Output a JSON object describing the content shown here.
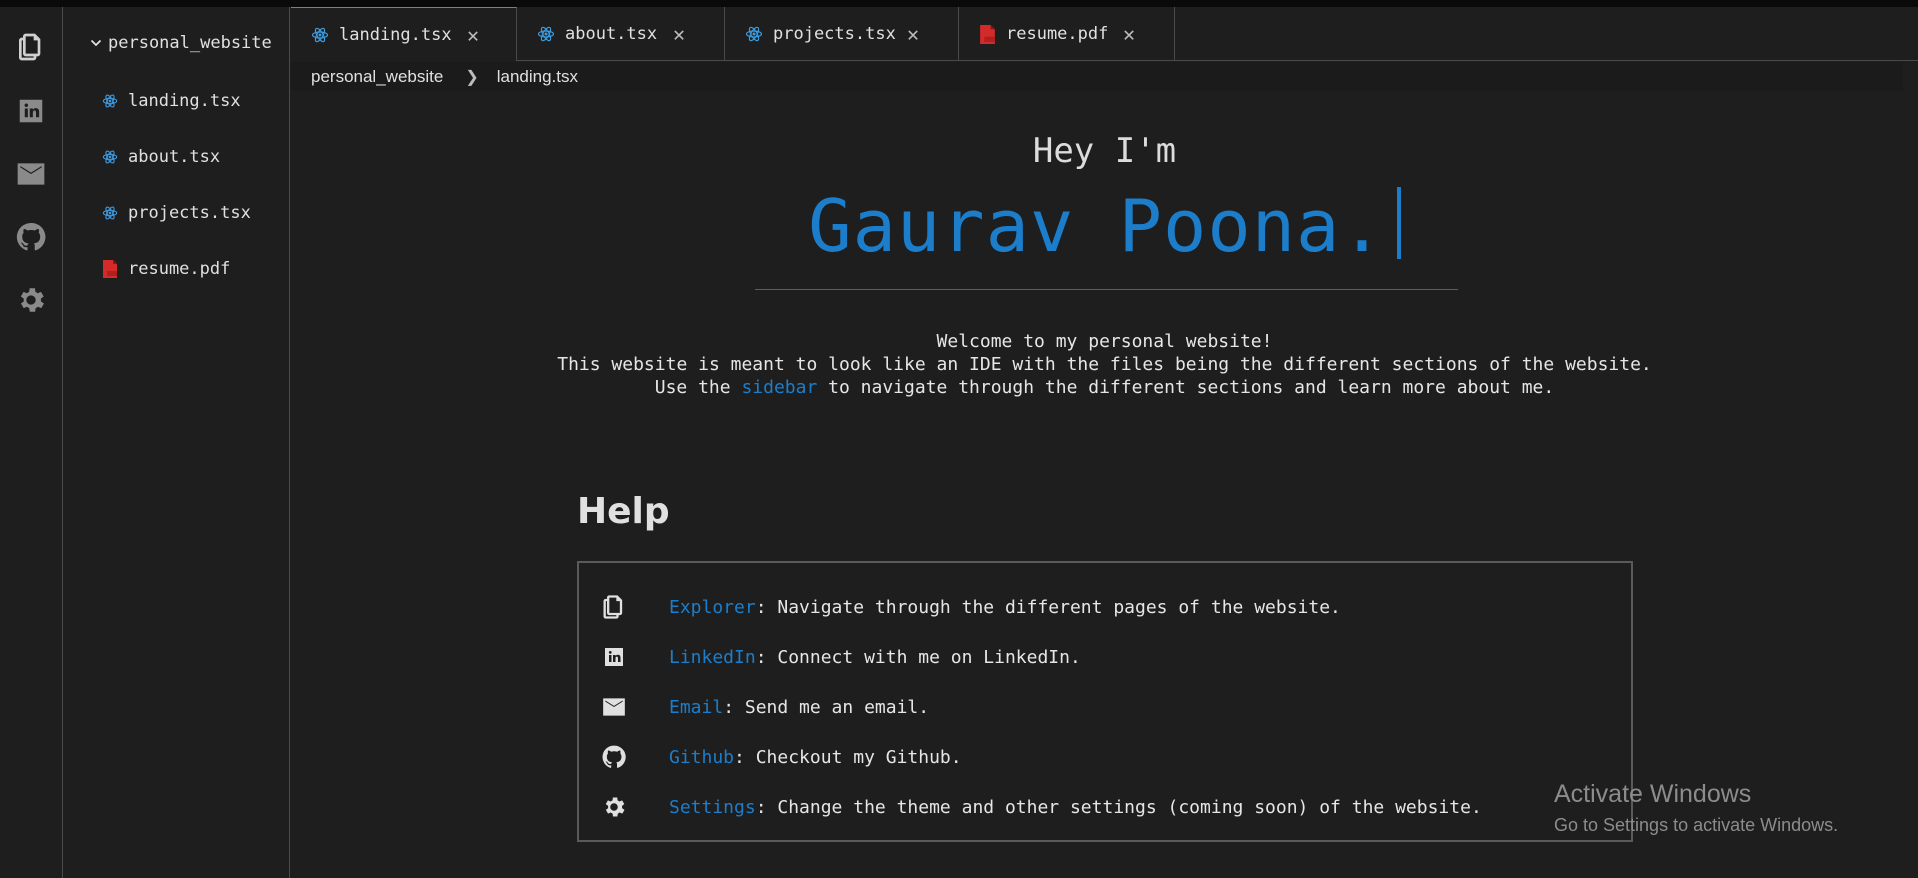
{
  "activity_bar": {
    "items": [
      {
        "name": "explorer",
        "icon": "files-icon"
      },
      {
        "name": "linkedin",
        "icon": "linkedin-icon"
      },
      {
        "name": "email",
        "icon": "mail-icon"
      },
      {
        "name": "github",
        "icon": "github-icon"
      },
      {
        "name": "settings",
        "icon": "gear-icon"
      }
    ]
  },
  "explorer": {
    "folder": "personal_website",
    "files": [
      {
        "label": "landing.tsx",
        "icon": "react-icon"
      },
      {
        "label": "about.tsx",
        "icon": "react-icon"
      },
      {
        "label": "projects.tsx",
        "icon": "react-icon"
      },
      {
        "label": "resume.pdf",
        "icon": "pdf-icon"
      }
    ]
  },
  "tabs": [
    {
      "label": "landing.tsx",
      "icon": "react-icon",
      "active": true
    },
    {
      "label": "about.tsx",
      "icon": "react-icon",
      "active": false
    },
    {
      "label": "projects.tsx",
      "icon": "react-icon",
      "active": false
    },
    {
      "label": "resume.pdf",
      "icon": "pdf-icon",
      "active": false
    }
  ],
  "breadcrumb": {
    "folder": "personal_website",
    "file": "landing.tsx"
  },
  "hero": {
    "greeting": "Hey I'm",
    "name": "Gaurav Poona."
  },
  "welcome": {
    "line1": "Welcome to my personal website!",
    "line2": "This website is meant to look like an IDE with the files being the different sections of the website.",
    "line3_pre": "Use the",
    "line3_link": "sidebar",
    "line3_post": "to navigate through the different sections and learn more about me."
  },
  "help": {
    "title": "Help",
    "items": [
      {
        "icon": "files-icon",
        "label": "Explorer",
        "text": ": Navigate through the different pages of the website."
      },
      {
        "icon": "linkedin-icon",
        "label": "LinkedIn",
        "text": ": Connect with me on LinkedIn."
      },
      {
        "icon": "mail-icon",
        "label": "Email",
        "text": ": Send me an email."
      },
      {
        "icon": "github-icon",
        "label": "Github",
        "text": ": Checkout my Github."
      },
      {
        "icon": "gear-icon",
        "label": "Settings",
        "text": ": Change the theme and other settings (coming soon) of the website."
      }
    ]
  },
  "watermark": {
    "title": "Activate Windows",
    "subtitle": "Go to Settings to activate Windows."
  },
  "colors": {
    "background": "#1e1e1e",
    "accent": "#1c7ecb",
    "react": "#3d9be0",
    "pdf": "#d32a2a",
    "border": "#4a4a4a"
  }
}
